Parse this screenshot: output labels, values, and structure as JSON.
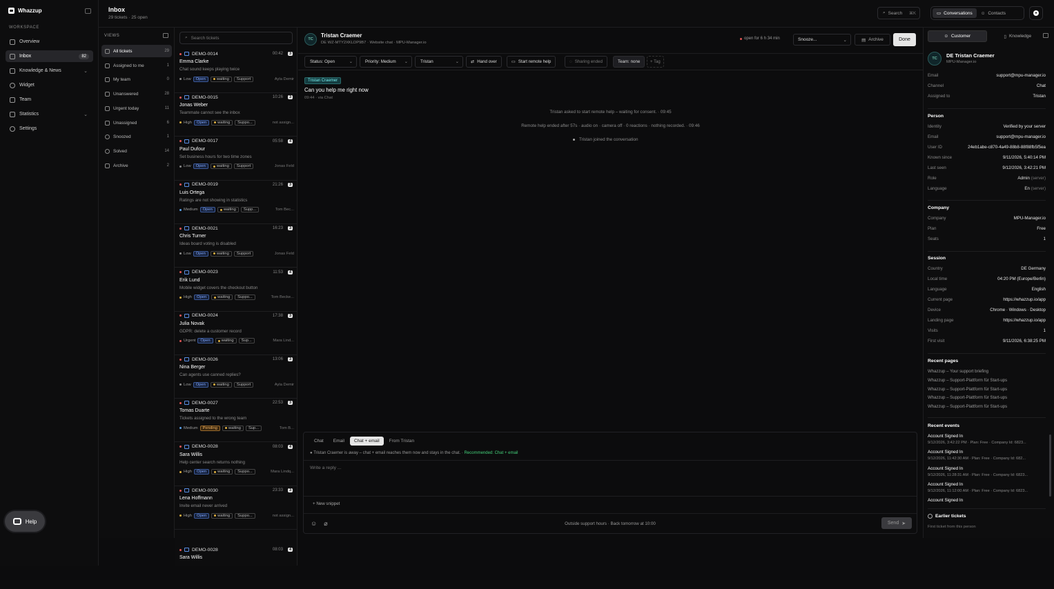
{
  "app": {
    "name": "Whazzup",
    "workspace_label": "WORKSPACE"
  },
  "nav": [
    {
      "label": "Overview"
    },
    {
      "label": "Inbox",
      "count": "82"
    },
    {
      "label": "Knowledge & News"
    },
    {
      "label": "Widget"
    },
    {
      "label": "Team"
    },
    {
      "label": "Statistics"
    },
    {
      "label": "Settings"
    }
  ],
  "help_label": "Help",
  "header": {
    "title": "Inbox",
    "subtitle": "29 tickets · 25 open",
    "search_label": "Search",
    "search_kbd": "⌘K",
    "tab_conversations": "Conversations",
    "tab_contacts": "Contacts"
  },
  "views": {
    "title": "VIEWS",
    "items": [
      {
        "label": "All tickets",
        "count": "29"
      },
      {
        "label": "Assigned to me",
        "count": "1"
      },
      {
        "label": "My team",
        "count": "0"
      },
      {
        "label": "Unanswered",
        "count": "28"
      },
      {
        "label": "Urgent today",
        "count": "11"
      },
      {
        "label": "Unassigned",
        "count": "6"
      },
      {
        "label": "Snoozed",
        "count": "1"
      },
      {
        "label": "Solved",
        "count": "14"
      },
      {
        "label": "Archive",
        "count": "2"
      }
    ]
  },
  "list": {
    "search_placeholder": "Search tickets",
    "tickets": [
      {
        "id": "DEMO-0014",
        "time": "00:42",
        "count": "3",
        "name": "Emma Clarke",
        "subject": "Chat sound keeps playing twice",
        "priority": "Low",
        "status": "Open",
        "waiting": "waiting",
        "team": "Support",
        "assignee": "Ayla Demir"
      },
      {
        "id": "DEMO-0015",
        "time": "10:26",
        "count": "3",
        "name": "Jonas Weber",
        "subject": "Teammate cannot see the inbox",
        "priority": "High",
        "status": "Open",
        "waiting": "waiting",
        "team": "Suppo...",
        "assignee": "not assign..."
      },
      {
        "id": "DEMO-0017",
        "time": "05:58",
        "count": "4",
        "name": "Paul Dufour",
        "subject": "Set business hours for two time zones",
        "priority": "Low",
        "status": "Open",
        "waiting": "waiting",
        "team": "Support",
        "assignee": "Jonas Feld"
      },
      {
        "id": "DEMO-0019",
        "time": "21:26",
        "count": "3",
        "name": "Luis Ortega",
        "subject": "Ratings are not showing in statistics",
        "priority": "Medium",
        "status": "Open",
        "waiting": "waiting",
        "team": "Supp...",
        "assignee": "Tom Bec..."
      },
      {
        "id": "DEMO-0021",
        "time": "16:23",
        "count": "3",
        "name": "Chris Turner",
        "subject": "Ideas board voting is disabled",
        "priority": "Low",
        "status": "Open",
        "waiting": "waiting",
        "team": "Support",
        "assignee": "Jonas Feld"
      },
      {
        "id": "DEMO-0023",
        "time": "11:53",
        "count": "4",
        "name": "Erik Lund",
        "subject": "Mobile widget covers the checkout button",
        "priority": "High",
        "status": "Open",
        "waiting": "waiting",
        "team": "Suppo...",
        "assignee": "Tom Becke..."
      },
      {
        "id": "DEMO-0024",
        "time": "17:38",
        "count": "3",
        "name": "Julia Novak",
        "subject": "GDPR: delete a customer record",
        "priority": "Urgent",
        "status": "Open",
        "waiting": "waiting",
        "team": "Sup...",
        "assignee": "Mara Lind..."
      },
      {
        "id": "DEMO-0026",
        "time": "13:06",
        "count": "3",
        "name": "Nina Berger",
        "subject": "Can agents use canned replies?",
        "priority": "Low",
        "status": "Open",
        "waiting": "waiting",
        "team": "Support",
        "assignee": "Ayla Demir"
      },
      {
        "id": "DEMO-0027",
        "time": "22:53",
        "count": "3",
        "name": "Tomas Duarte",
        "subject": "Tickets assigned to the wrong team",
        "priority": "Medium",
        "status": "Pending",
        "waiting": "waiting",
        "team": "Sup...",
        "assignee": "Tom B..."
      },
      {
        "id": "DEMO-0028",
        "time": "08:03",
        "count": "4",
        "name": "Sara Willis",
        "subject": "Help center search returns nothing",
        "priority": "High",
        "status": "Open",
        "waiting": "waiting",
        "team": "Suppo...",
        "assignee": "Mara Lindq..."
      },
      {
        "id": "DEMO-0030",
        "time": "23:33",
        "count": "3",
        "name": "Lena Hoffmann",
        "subject": "Invite email never arrived",
        "priority": "High",
        "status": "Open",
        "waiting": "waiting",
        "team": "Suppo...",
        "assignee": "not assign..."
      }
    ],
    "ghost": {
      "id": "DEMO-0028",
      "time": "08:03",
      "count": "4",
      "name": "Sara Willis"
    }
  },
  "conversation": {
    "initials": "TC",
    "name": "Tristan Craemer",
    "meta": "DE WZ-MTY2XKLDP9B7 · Website chat · MPU-Manager.io",
    "open_for": "open for 6 h 34 min",
    "snooze": "Snooze...",
    "archive": "Archive",
    "done": "Done",
    "toolbar": {
      "status": "Status: Open",
      "priority": "Priority: Medium",
      "assignee": "Tristan",
      "handover": "Hand over",
      "remote": "Start remote help",
      "sharing": "Sharing ended",
      "team": "Team: none",
      "tag": "+ Tag"
    },
    "message": {
      "author": "Tristan Craemer",
      "text": "Can you help me right now",
      "meta": "09:44 · via Chat"
    },
    "system": [
      "Tristan asked to start remote help – waiting for consent. · 09:45",
      "Remote help ended after 57s · audio on · camera off · 0 reactions · nothing recorded. · 09:46"
    ],
    "joined": "Tristan joined the conversation",
    "composer": {
      "tabs": [
        "Chat",
        "Email",
        "Chat + email"
      ],
      "from": "From Tristan",
      "hint": "Tristan Craemer is away – chat + email reaches them now and stays in the chat.",
      "recommended": "Recommended: Chat + email",
      "placeholder": "Write a reply ...",
      "snippet": "+ New snippet",
      "outside": "Outside support hours · Back tomorrow at 10:00",
      "send": "Send"
    }
  },
  "customer": {
    "tab_customer": "Customer",
    "tab_knowledge": "Knowledge",
    "initials": "TC",
    "name": "DE Tristan Craemer",
    "company_sub": "MPU-Manager.io",
    "basic": [
      {
        "k": "Email",
        "v": "support@mpu-manager.io"
      },
      {
        "k": "Channel",
        "v": "Chat"
      },
      {
        "k": "Assigned to",
        "v": "Tristan"
      }
    ],
    "person_title": "Person",
    "person": [
      {
        "k": "Identity",
        "v": "Verified by your server"
      },
      {
        "k": "Email",
        "v": "support@mpu-manager.io"
      },
      {
        "k": "User ID",
        "v": "24eb1abe-c870-4a49-88b8-88f88fb5f5ea"
      },
      {
        "k": "Known since",
        "v": "9/11/2026, 5:40:14 PM"
      },
      {
        "k": "Last seen",
        "v": "9/12/2026, 3:42:21 PM"
      },
      {
        "k": "Role",
        "v": "Admin",
        "srv": "(server)"
      },
      {
        "k": "Language",
        "v": "En",
        "srv": "(server)"
      }
    ],
    "company_title": "Company",
    "company": [
      {
        "k": "Company",
        "v": "MPU-Manager.io"
      },
      {
        "k": "Plan",
        "v": "Free"
      },
      {
        "k": "Seats",
        "v": "1"
      }
    ],
    "session_title": "Session",
    "session": [
      {
        "k": "Country",
        "v": "DE Germany"
      },
      {
        "k": "Local time",
        "v": "04:20 PM (Europe/Berlin)"
      },
      {
        "k": "Language",
        "v": "English"
      },
      {
        "k": "Current page",
        "v": "https://whazzup.io/app"
      },
      {
        "k": "Device",
        "v": "Chrome · Windows · Desktop"
      },
      {
        "k": "Landing page",
        "v": "https://whazzup.io/app"
      },
      {
        "k": "Visits",
        "v": "1"
      },
      {
        "k": "First visit",
        "v": "9/11/2026, 6:38:25 PM"
      }
    ],
    "recent_pages_title": "Recent pages",
    "recent_pages": [
      "Whazzup – Your support briefing",
      "Whazzup – Support-Plattform für Start-ups",
      "Whazzup – Support-Plattform für Start-ups",
      "Whazzup – Support-Plattform für Start-ups",
      "Whazzup – Support-Plattform für Start-ups"
    ],
    "recent_events_title": "Recent events",
    "events": [
      {
        "t": "Account Signed In",
        "s": "9/12/2026, 3:42:22 PM · Plan: Free · Company Id: 6823..."
      },
      {
        "t": "Account Signed In",
        "s": "9/12/2026, 11:42:30 AM · Plan: Free · Company Id: 682..."
      },
      {
        "t": "Account Signed In",
        "s": "9/12/2026, 11:28:31 AM · Plan: Free · Company Id: 6823..."
      },
      {
        "t": "Account Signed In",
        "s": "9/12/2026, 11:12:00 AM · Plan: Free · Company Id: 6823..."
      },
      {
        "t": "Account Signed In",
        "s": ""
      }
    ],
    "earlier_title": "Earlier tickets",
    "earlier_sub": "First ticket from this person"
  }
}
